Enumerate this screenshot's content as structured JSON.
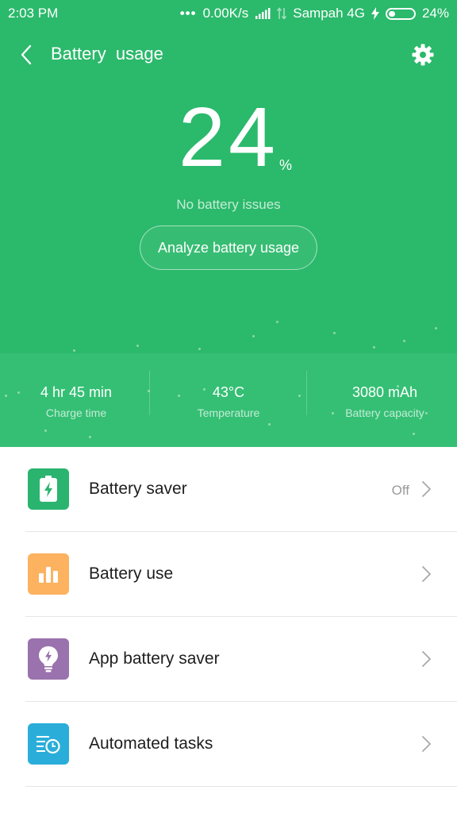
{
  "status_bar": {
    "time": "2:03 PM",
    "dots": "•••",
    "speed": "0.00K/s",
    "carrier": "Sampah 4G",
    "battery": "24%"
  },
  "header": {
    "title": "Battery  usage"
  },
  "battery": {
    "percent": "24",
    "unit": "%",
    "status": "No battery issues",
    "analyze_label": "Analyze battery usage"
  },
  "stats": [
    {
      "value": "4 hr 45 min",
      "label": "Charge time"
    },
    {
      "value": "43°C",
      "label": "Temperature"
    },
    {
      "value": "3080 mAh",
      "label": "Battery capacity"
    }
  ],
  "list": [
    {
      "label": "Battery saver",
      "value": "Off",
      "icon": "battery-charging-icon",
      "color": "#2ab46f"
    },
    {
      "label": "Battery use",
      "value": "",
      "icon": "bar-chart-icon",
      "color": "#fcb25f"
    },
    {
      "label": "App battery saver",
      "value": "",
      "icon": "lightbulb-bolt-icon",
      "color": "#9a72ad"
    },
    {
      "label": "Automated tasks",
      "value": "",
      "icon": "scheduled-list-icon",
      "color": "#2aaed9"
    }
  ],
  "colors": {
    "hero": "#2bb96b",
    "stats_strip": "#35bf74"
  }
}
